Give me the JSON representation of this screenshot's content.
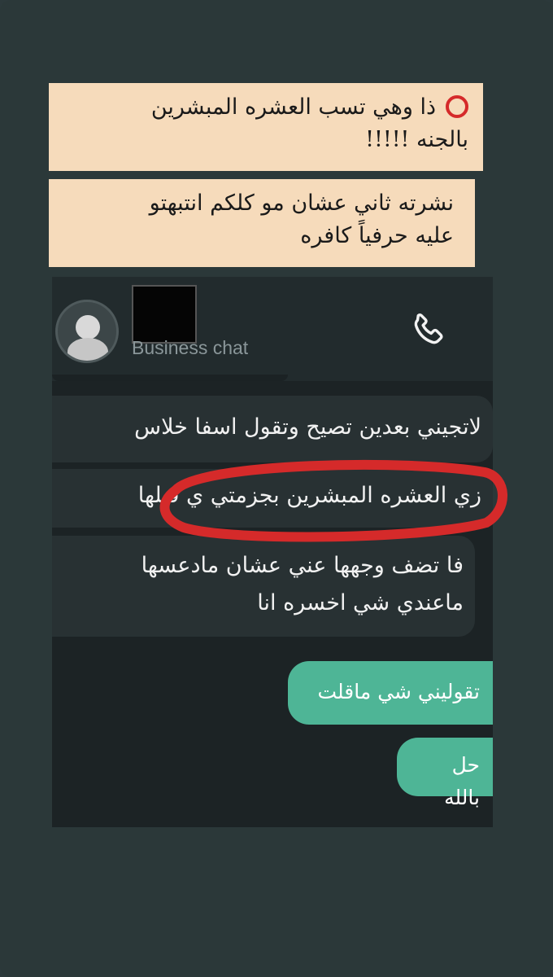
{
  "captions": {
    "first_line1": "ذا وهي تسب العشره المبشرين",
    "first_line2": "بالجنه !!!!!",
    "second_line1": "نشرته ثاني عشان مو كلكم انتبهتو",
    "second_line2": "عليه حرفياً كافره"
  },
  "chat": {
    "subtitle": "Business chat",
    "incoming": [
      {
        "text": "لاتجيني بعدين تصيح وتقول اسفا خلاس"
      },
      {
        "text": "زي العشره المبشرين بجزمتي  ي قبلها"
      },
      {
        "text": "فا تضف وجهها عني عشان مادعسها",
        "text2": "ماعندي شي اخسره انا"
      }
    ],
    "outgoing": [
      {
        "text": "تقوليني شي ماقلت"
      },
      {
        "text": "حل بالله"
      }
    ]
  },
  "icons": {
    "marker": "red-circle-icon",
    "call": "phone-icon",
    "avatar": "profile-avatar"
  },
  "colors": {
    "caption_bg": "#f6dbbb",
    "accent_red": "#d52a2a",
    "outgoing_bubble": "#4eb596",
    "incoming_bubble": "#283133"
  }
}
